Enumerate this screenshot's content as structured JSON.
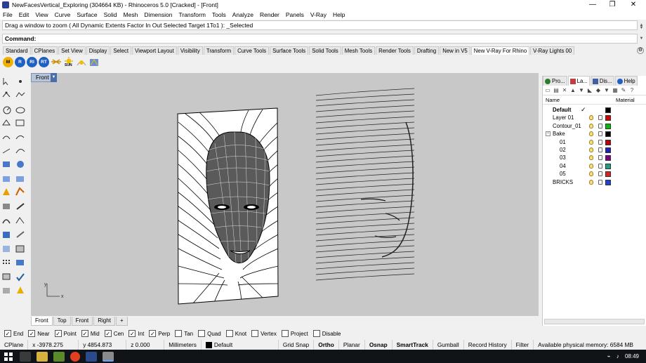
{
  "window": {
    "title": "NewFacesVertical_Exploring (304664 KB) - Rhinoceros 5.0 [Cracked] - [Front]",
    "minimize": "—",
    "restore": "❐",
    "close": "✕"
  },
  "menu": [
    "File",
    "Edit",
    "View",
    "Curve",
    "Surface",
    "Solid",
    "Mesh",
    "Dimension",
    "Transform",
    "Tools",
    "Analyze",
    "Render",
    "Panels",
    "V-Ray",
    "Help"
  ],
  "command": {
    "history": "Drag a window to zoom ( All  Dynamic  Extents  Factor  In  Out  Selected  Target  1To1 ): _Selected",
    "prompt": "Command:"
  },
  "toolbar_tabs": [
    "Standard",
    "CPlanes",
    "Set View",
    "Display",
    "Select",
    "Viewport Layout",
    "Visibility",
    "Transform",
    "Curve Tools",
    "Surface Tools",
    "Solid Tools",
    "Mesh Tools",
    "Render Tools",
    "Drafting",
    "New in V5",
    "New V-Ray For Rhino",
    "V-Ray Lights 00"
  ],
  "toolbar_icons": [
    {
      "name": "vray-m-icon",
      "label": "M",
      "color": "#f0b000"
    },
    {
      "name": "vray-r-icon",
      "label": "R",
      "color": "#2060c0"
    },
    {
      "name": "vray-ri-icon",
      "label": "RI",
      "color": "#2060c0"
    },
    {
      "name": "vray-rt-icon",
      "label": "RT",
      "color": "#2060c0"
    }
  ],
  "sun_label": "SUN",
  "viewport": {
    "name": "Front",
    "tabs": [
      "Front",
      "Top",
      "Front",
      "Right"
    ],
    "add_tab": "+",
    "axis_x": "x",
    "axis_y": "y"
  },
  "panel": {
    "tabs": [
      "Pro...",
      "La...",
      "Dis...",
      "Help"
    ],
    "columns": {
      "name": "Name",
      "material": "Material"
    },
    "layers": [
      {
        "name": "Default",
        "bold": true,
        "current": true,
        "color": "#000000",
        "indent": 14
      },
      {
        "name": "Layer 01",
        "color": "#e00000",
        "indent": 14
      },
      {
        "name": "Contour_01",
        "color": "#00c000",
        "indent": 14
      },
      {
        "name": "Bake",
        "color": "#000000",
        "indent": 14,
        "tree": "−"
      },
      {
        "name": "01",
        "color": "#c00000",
        "indent": 24
      },
      {
        "name": "02",
        "color": "#2020c0",
        "indent": 24
      },
      {
        "name": "03",
        "color": "#800080",
        "indent": 24
      },
      {
        "name": "04",
        "color": "#20a080",
        "indent": 24
      },
      {
        "name": "05",
        "color": "#e02020",
        "indent": 24
      },
      {
        "name": "BRICKS",
        "color": "#2040e0",
        "indent": 14
      }
    ],
    "current_mark": "✓"
  },
  "osnaps": [
    {
      "label": "End",
      "checked": true
    },
    {
      "label": "Near",
      "checked": true
    },
    {
      "label": "Point",
      "checked": true
    },
    {
      "label": "Mid",
      "checked": true
    },
    {
      "label": "Cen",
      "checked": true
    },
    {
      "label": "Int",
      "checked": true
    },
    {
      "label": "Perp",
      "checked": true
    },
    {
      "label": "Tan",
      "checked": false
    },
    {
      "label": "Quad",
      "checked": false
    },
    {
      "label": "Knot",
      "checked": false
    },
    {
      "label": "Vertex",
      "checked": false
    },
    {
      "label": "Project",
      "checked": false
    },
    {
      "label": "Disable",
      "checked": false
    }
  ],
  "status": {
    "cplane": "CPlane",
    "x": "x -3978.275",
    "y": "y 4854.873",
    "z": "z 0.000",
    "units": "Millimeters",
    "layer": "Default",
    "grid_snap": "Grid Snap",
    "ortho": "Ortho",
    "planar": "Planar",
    "osnap": "Osnap",
    "smarttrack": "SmartTrack",
    "gumball": "Gumball",
    "record_history": "Record History",
    "filter": "Filter",
    "memory": "Available physical memory: 6584 MB"
  },
  "taskbar": {
    "time": "08:49"
  }
}
